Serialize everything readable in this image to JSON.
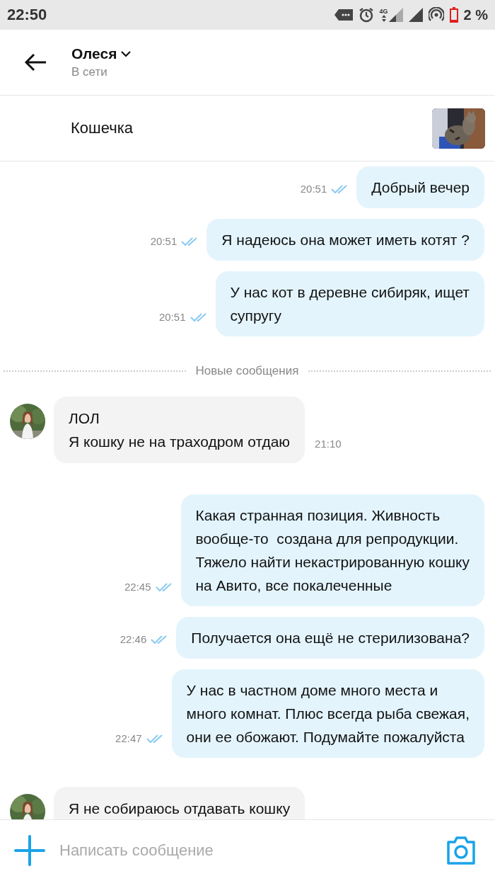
{
  "status_bar": {
    "time": "22:50",
    "network": "4G",
    "battery": "2 %"
  },
  "header": {
    "name": "Олеся",
    "status": "В сети"
  },
  "listing": {
    "title": "Кошечка"
  },
  "messages": [
    {
      "kind": "outgoing",
      "lines": [
        "Добрый вечер"
      ],
      "time": "20:51",
      "read": true
    },
    {
      "kind": "outgoing",
      "lines": [
        "Я надеюсь она может иметь котят ?"
      ],
      "time": "20:51",
      "read": true
    },
    {
      "kind": "outgoing",
      "lines": [
        "У нас кот в деревне сибиряк, ищет",
        "супругу"
      ],
      "time": "20:51",
      "read": true
    },
    {
      "kind": "divider",
      "text": "Новые сообщения"
    },
    {
      "kind": "incoming",
      "lines": [
        "ЛОЛ",
        "Я кошку не на траходром отдаю"
      ],
      "time": "21:10"
    },
    {
      "kind": "outgoing",
      "lines": [
        "Какая странная позиция. Живность",
        "вообще-то  создана для репродукции.",
        "Тяжело найти некастрированную кошку",
        "на Авито, все покалеченные"
      ],
      "time": "22:45",
      "read": true
    },
    {
      "kind": "outgoing",
      "lines": [
        "Получается она ещё не стерилизована?"
      ],
      "time": "22:46",
      "read": true
    },
    {
      "kind": "outgoing",
      "lines": [
        "У нас в частном доме много места и",
        "много комнат. Плюс всегда рыба свежая,",
        "они ее обожают. Подумайте пожалуйста"
      ],
      "time": "22:47",
      "read": true
    },
    {
      "kind": "incoming",
      "lines": [
        "Я не собираюсь отдавать кошку"
      ]
    }
  ],
  "composer": {
    "placeholder": "Написать сообщение"
  }
}
